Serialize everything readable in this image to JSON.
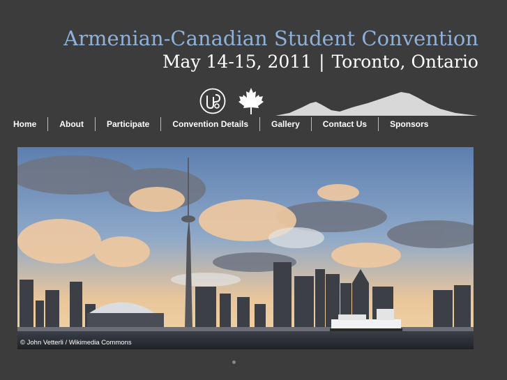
{
  "header": {
    "title": "Armenian-Canadian Student Convention",
    "date": "May 14-15, 2011",
    "separator": "|",
    "location": "Toronto, Ontario"
  },
  "icons": {
    "logo": "acsc-logo-icon",
    "leaf": "maple-leaf-icon",
    "mountain": "mount-ararat-icon"
  },
  "nav": {
    "items": [
      {
        "label": "Home"
      },
      {
        "label": "About"
      },
      {
        "label": "Participate"
      },
      {
        "label": "Convention Details"
      },
      {
        "label": "Gallery"
      },
      {
        "label": "Contact Us"
      },
      {
        "label": "Sponsors"
      }
    ]
  },
  "hero": {
    "credit": "© John Vetterli / Wikimedia Commons"
  },
  "colors": {
    "background": "#3c3c3c",
    "title": "#8fb0d8",
    "text": "#ffffff"
  }
}
